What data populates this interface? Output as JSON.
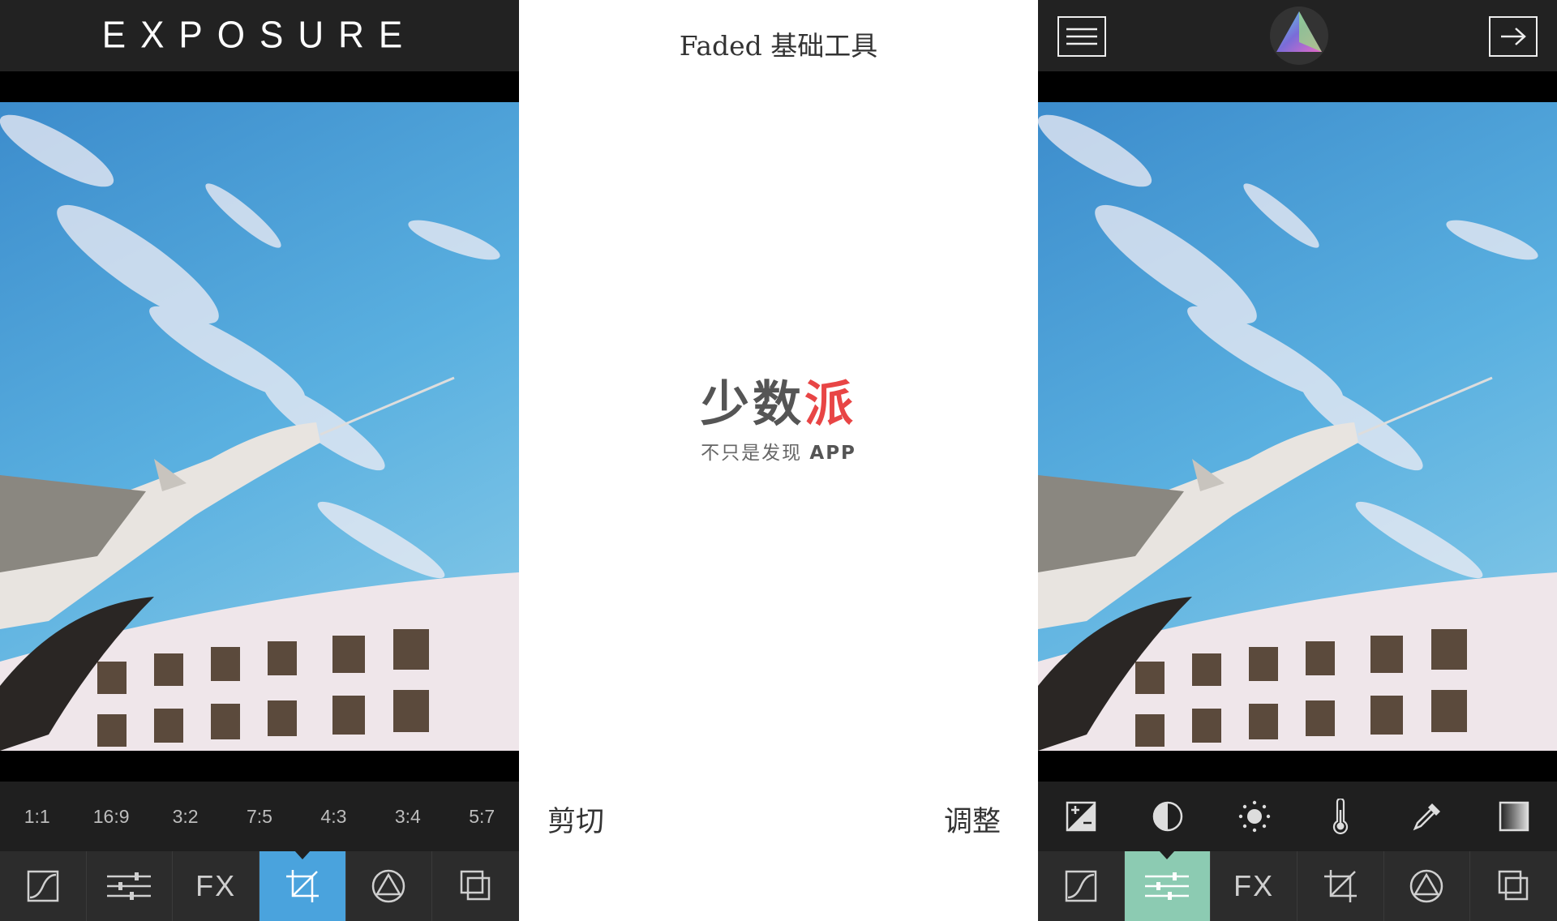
{
  "left": {
    "app_title": "EXPOSURE",
    "ratios": [
      "1:1",
      "16:9",
      "3:2",
      "7:5",
      "4:3",
      "3:4",
      "5:7"
    ],
    "tools": [
      {
        "name": "curves-icon"
      },
      {
        "name": "sliders-icon"
      },
      {
        "name": "fx",
        "label": "FX"
      },
      {
        "name": "crop-icon",
        "active": true
      },
      {
        "name": "triangle-circle-icon"
      },
      {
        "name": "layers-icon"
      }
    ],
    "active_color": "#4aa3dd"
  },
  "middle": {
    "title": "Faded  基础工具",
    "brand": {
      "part1": "少数",
      "part2": "派",
      "tagline": "不只是发现",
      "tagline_app": "APP"
    },
    "caption_left": "剪切",
    "caption_right": "调整",
    "brand_red": "#e84545"
  },
  "right": {
    "adjust_icons": [
      "exposure-icon",
      "contrast-icon",
      "brightness-icon",
      "temperature-icon",
      "eyedropper-icon",
      "fade-icon"
    ],
    "tools": [
      {
        "name": "curves-icon"
      },
      {
        "name": "sliders-icon",
        "active": true
      },
      {
        "name": "fx",
        "label": "FX"
      },
      {
        "name": "crop-icon"
      },
      {
        "name": "triangle-circle-icon"
      },
      {
        "name": "layers-icon"
      }
    ],
    "active_color": "#8ccbb2"
  }
}
